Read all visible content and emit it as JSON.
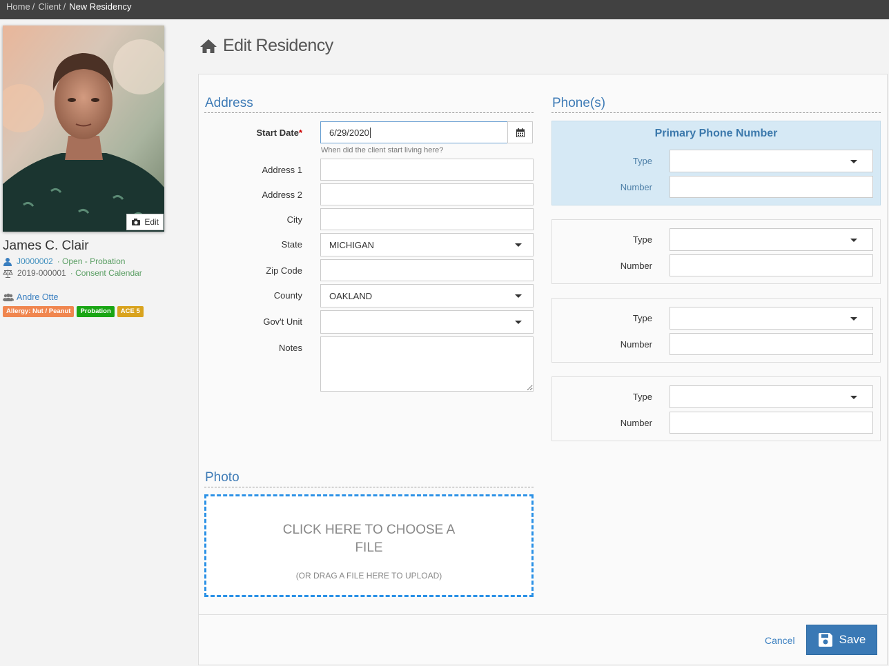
{
  "breadcrumb": [
    {
      "label": "Home"
    },
    {
      "label": "Client"
    },
    {
      "label": "New Residency"
    }
  ],
  "breadcrumb_sep": "/",
  "profile": {
    "photo_edit_label": "Edit",
    "name": "James C. Clair",
    "client_id": "J0000002",
    "status": "· Open - Probation",
    "case_number": "2019-000001",
    "case_type": "· Consent Calendar",
    "caseworker": "Andre Otte",
    "badges": [
      {
        "label": "Allergy: Nut / Peanut",
        "color": "#f0864f"
      },
      {
        "label": "Probation",
        "color": "#19a514"
      },
      {
        "label": "ACE 5",
        "color": "#d9a31e"
      }
    ]
  },
  "page_title": "Edit Residency",
  "address": {
    "section_title": "Address",
    "start_date_label": "Start Date",
    "start_date_required": "*",
    "start_date_value": "6/29/2020",
    "start_date_help": "When did the client start living here?",
    "address1_label": "Address 1",
    "address1_value": "",
    "address2_label": "Address 2",
    "address2_value": "",
    "city_label": "City",
    "city_value": "",
    "state_label": "State",
    "state_value": "MICHIGAN",
    "zip_label": "Zip Code",
    "zip_value": "",
    "county_label": "County",
    "county_value": "OAKLAND",
    "govunit_label": "Gov't Unit",
    "govunit_value": "",
    "notes_label": "Notes",
    "notes_value": ""
  },
  "phones": {
    "section_title": "Phone(s)",
    "primary_title": "Primary Phone Number",
    "type_label": "Type",
    "number_label": "Number",
    "entries": [
      {
        "type": "",
        "number": ""
      },
      {
        "type": "",
        "number": ""
      },
      {
        "type": "",
        "number": ""
      },
      {
        "type": "",
        "number": ""
      }
    ]
  },
  "photo": {
    "section_title": "Photo",
    "dropzone_line1": "CLICK HERE TO CHOOSE A",
    "dropzone_line2": "FILE",
    "dropzone_sub": "(OR DRAG A FILE HERE TO UPLOAD)"
  },
  "actions": {
    "cancel_label": "Cancel",
    "save_label": "Save"
  },
  "colors": {
    "accent": "#3a79b5",
    "section_title": "#3e7bb6",
    "primary_phone_bg": "#d6e9f5",
    "dropzone_border": "#2b91e6"
  }
}
